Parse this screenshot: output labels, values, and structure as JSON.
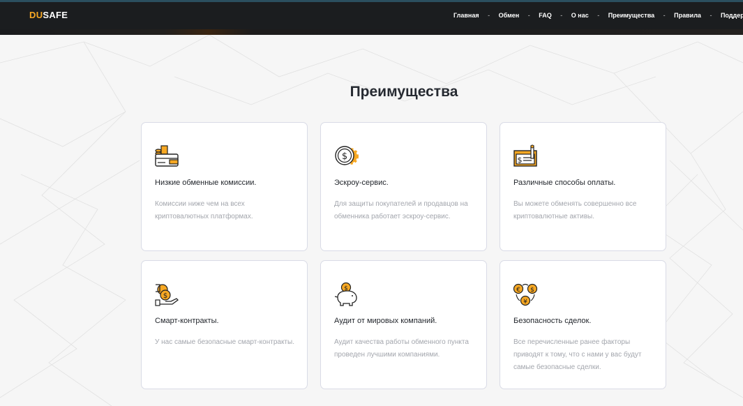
{
  "header": {
    "logo_accent": "DU",
    "logo_rest": "SAFE",
    "nav": [
      "Главная",
      "Обмен",
      "FAQ",
      "О нас",
      "Преимущества",
      "Правила",
      "Поддерж"
    ],
    "separator": "-"
  },
  "section_title": "Преимущества",
  "colors": {
    "accent": "#f7a823",
    "navbar": "#1b1d1f",
    "card_border": "#d9dbe6",
    "desc_text": "#a3a6ad"
  },
  "cards": [
    {
      "icon": "wallet-coins-icon",
      "title": "Низкие обменные комиссии.",
      "desc": "Комиссии ниже чем на всех криптовалютных платформах."
    },
    {
      "icon": "coin-gear-icon",
      "title": "Эскроу-сервис.",
      "desc": "Для защиты покупателей и продавцов на обменника работает эскроу-сервис."
    },
    {
      "icon": "payment-terminal-icon",
      "title": "Различные способы оплаты.",
      "desc": "Вы можете обменять совершенно все криптовалютные активы."
    },
    {
      "icon": "hand-coins-icon",
      "title": "Смарт-контракты.",
      "desc": "У нас самые безопасные смарт-контракты."
    },
    {
      "icon": "piggy-bank-icon",
      "title": "Аудит от мировых компаний.",
      "desc": "Аудит качества работы обменного пункта проведен лучшими компаниями."
    },
    {
      "icon": "currency-exchange-icon",
      "title": "Безопасность сделок.",
      "desc": "Все перечисленные ранее факторы приводят к тому, что с нами у вас будут самые безопасные сделки."
    }
  ]
}
